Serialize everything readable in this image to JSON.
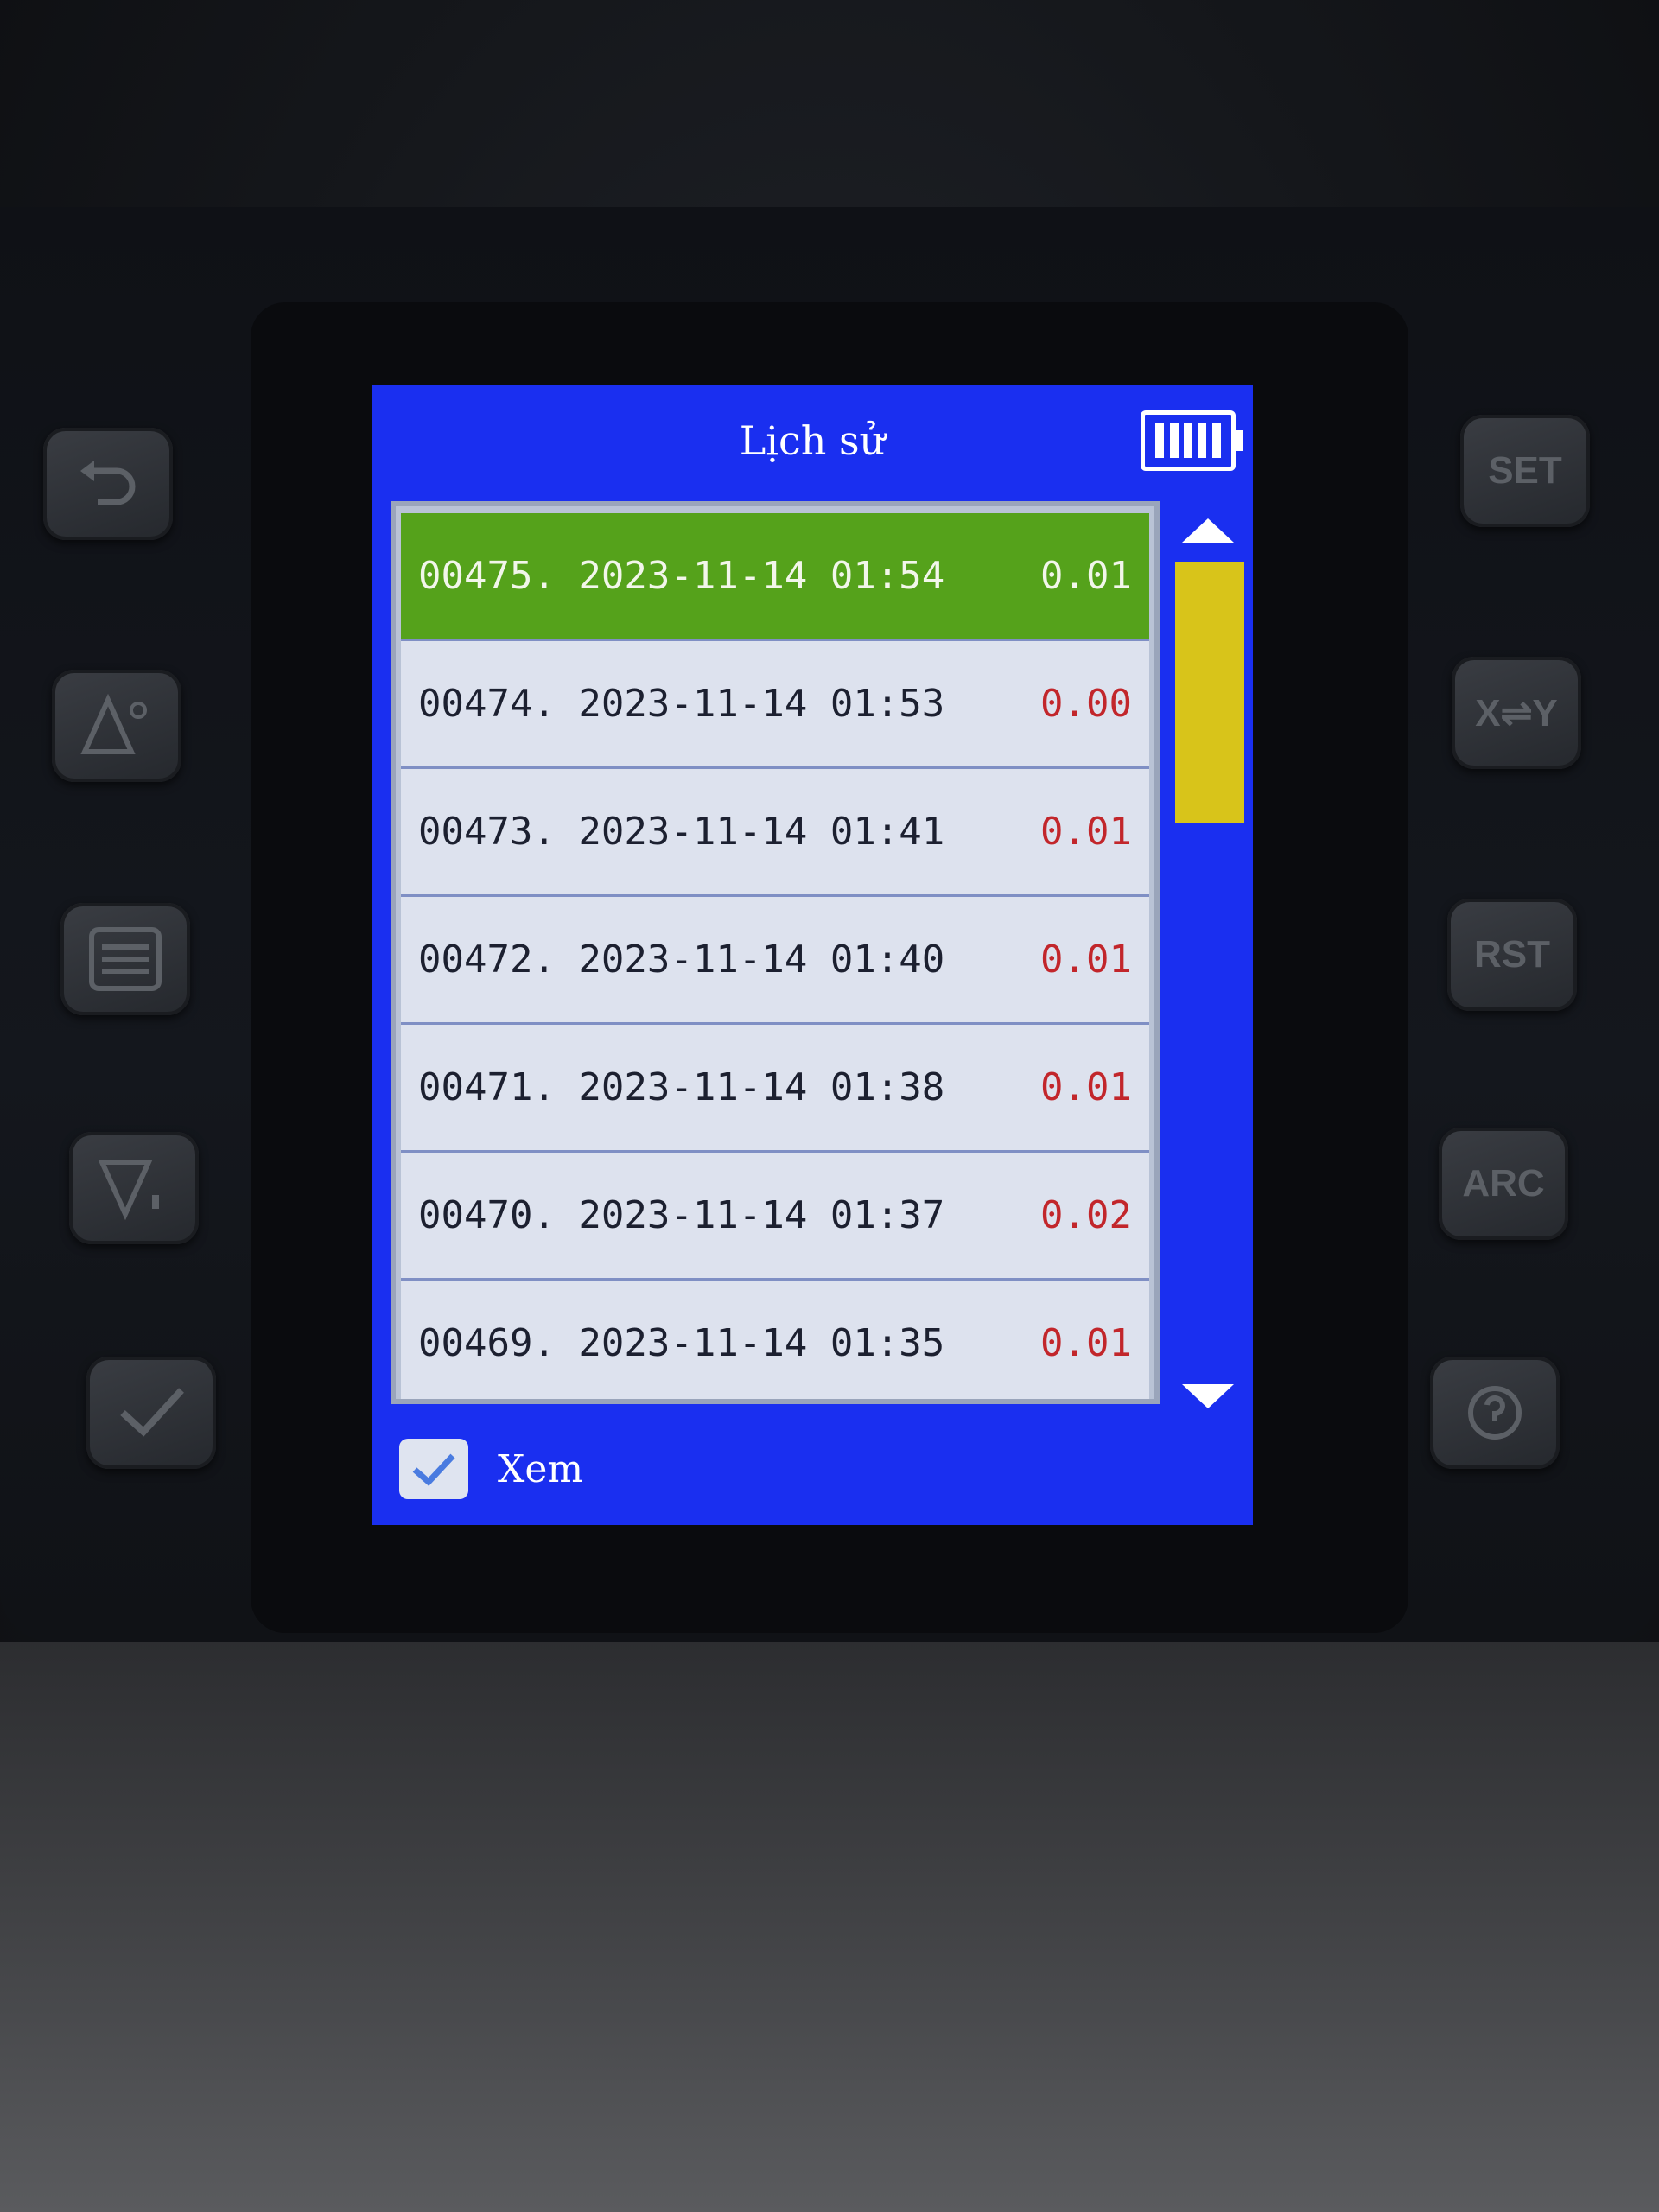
{
  "header": {
    "title": "Lịch sử",
    "battery_icon": "battery-full-icon"
  },
  "history": {
    "rows": [
      {
        "entry": "00475. 2023-11-14 01:54",
        "value": "0.01",
        "selected": true
      },
      {
        "entry": "00474. 2023-11-14 01:53",
        "value": "0.00",
        "selected": false
      },
      {
        "entry": "00473. 2023-11-14 01:41",
        "value": "0.01",
        "selected": false
      },
      {
        "entry": "00472. 2023-11-14 01:40",
        "value": "0.01",
        "selected": false
      },
      {
        "entry": "00471. 2023-11-14 01:38",
        "value": "0.01",
        "selected": false
      },
      {
        "entry": "00470. 2023-11-14 01:37",
        "value": "0.02",
        "selected": false
      },
      {
        "entry": "00469. 2023-11-14 01:35",
        "value": "0.01",
        "selected": false
      }
    ]
  },
  "scrollbar": {
    "position_fraction": 0.0,
    "visible_fraction": 0.22
  },
  "footer": {
    "view_label": "Xem",
    "checked": true
  },
  "hardware_buttons": {
    "left": [
      "back-icon",
      "brightness-up-icon",
      "menu-list-icon",
      "volume-down-icon",
      "confirm-check-icon"
    ],
    "right": [
      "SET",
      "X⇌Y",
      "RST",
      "ARC",
      "help-icon"
    ]
  },
  "colors": {
    "screen_bg": "#1a2ff0",
    "selected_row": "#55a21b",
    "value_text": "#c2262b",
    "scroll_thumb": "#d8c41a"
  }
}
